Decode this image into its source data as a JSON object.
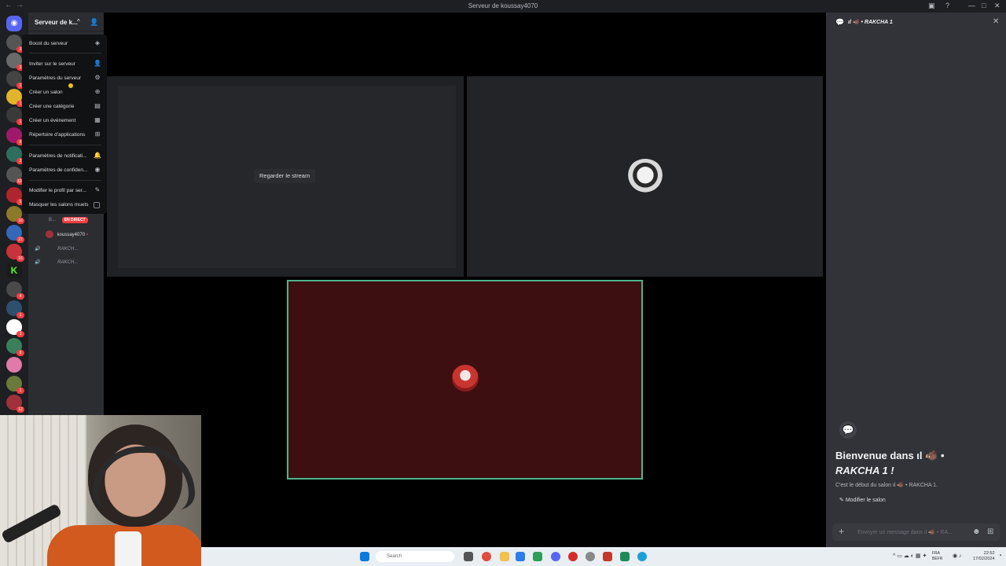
{
  "window": {
    "title": "Serveur de koussay4070",
    "back": "←",
    "forward": "→",
    "controls": [
      "—",
      "□",
      "✕"
    ]
  },
  "server": {
    "name": "Serveur de k...",
    "chevron": "^"
  },
  "rail_badges": [
    "3",
    "3",
    "1",
    "1",
    "1",
    "8",
    "2",
    "324",
    "5",
    "16",
    "27",
    "16",
    "4",
    "1",
    "3",
    "8",
    "1",
    "12"
  ],
  "menu": {
    "items": [
      {
        "label": "Boost du serveur",
        "icon": "boost-icon",
        "glyph": "◈"
      },
      {
        "label": "Inviter sur le serveur",
        "icon": "invite-person-icon",
        "glyph": "👤"
      },
      {
        "label": "Paramètres du serveur",
        "icon": "gear-icon",
        "glyph": "⚙"
      },
      {
        "label": "Créer un salon",
        "icon": "plus-circle-icon",
        "glyph": "⊕"
      },
      {
        "label": "Créer une catégorie",
        "icon": "folder-plus-icon",
        "glyph": "▤"
      },
      {
        "label": "Créer un événement",
        "icon": "calendar-plus-icon",
        "glyph": "▦"
      },
      {
        "label": "Répertoire d'applications",
        "icon": "app-grid-icon",
        "glyph": "⊞"
      },
      {
        "label": "Paramètres de notificati...",
        "icon": "bell-icon",
        "glyph": "🔔"
      },
      {
        "label": "Paramètres de confiden...",
        "icon": "shield-icon",
        "glyph": "◉"
      },
      {
        "label": "Modifier le profil par ser...",
        "icon": "pencil-icon",
        "glyph": "✎"
      },
      {
        "label": "Masquer les salons muets",
        "icon": "checkbox-icon",
        "glyph": ""
      }
    ]
  },
  "voice": {
    "user1": "B...",
    "live_badge": "EN DIRECT",
    "user2": "koussay4070",
    "channel1": "RAKCH...",
    "channel2": "RAKCH..."
  },
  "stage": {
    "watch_label": "Regarder le stream"
  },
  "chat": {
    "header_title": "ıl 🐗 • RAKCHA 1",
    "welcome_prefix": "Bienvenue dans ıl 🐗 •",
    "welcome_name": "RAKCHA 1 !",
    "start_line": "C'est le début du salon ıl 🐗 • RAKCHA 1.",
    "edit_label": "Modifier le salon",
    "input_placeholder": "Envoyer un message dans ıl 🐗 • RA...",
    "close": "✕"
  },
  "taskbar": {
    "search_placeholder": "Search",
    "lang": "FRA\nBEFR",
    "time": "22:52",
    "date": "17/02/2024"
  },
  "colors": {
    "accent_green": "#4bb58a",
    "live_red": "#f23f43",
    "tile3_bg": "#3e0f10"
  }
}
